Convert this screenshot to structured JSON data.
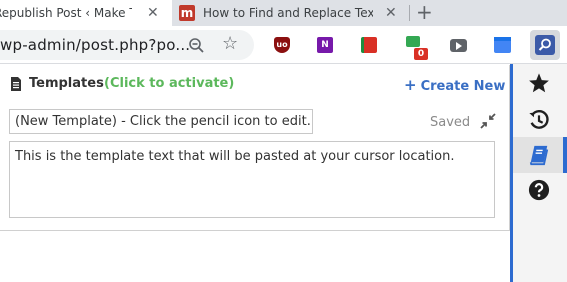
{
  "tabs": [
    {
      "title": "Republish Post ‹ Make Tech E",
      "active": true,
      "close": "✕"
    },
    {
      "title": "How to Find and Replace Text in",
      "active": false,
      "close": "✕",
      "favicon_letter": "m"
    }
  ],
  "new_tab_label": "+",
  "address_bar": {
    "url": "wp-admin/post.php?po..."
  },
  "extensions": {
    "ublock_label": "uo",
    "onenote_label": "N",
    "badge_count": "0"
  },
  "panel": {
    "title": "Templates",
    "activate_hint": "(Click to activate)",
    "create_new_plus": "+",
    "create_new_label": "Create New",
    "template_name_value": "(New Template) - Click the pencil icon to edit.",
    "saved_status": "Saved",
    "template_text": "This is the template text that will be pasted at your cursor location."
  },
  "sidebar": {
    "items": [
      "favorites",
      "history",
      "templates",
      "help"
    ],
    "active": "templates"
  },
  "colors": {
    "accent_blue": "#2d6bd0",
    "activate_green": "#5cb85c",
    "create_new_blue": "#3a6fc4"
  }
}
